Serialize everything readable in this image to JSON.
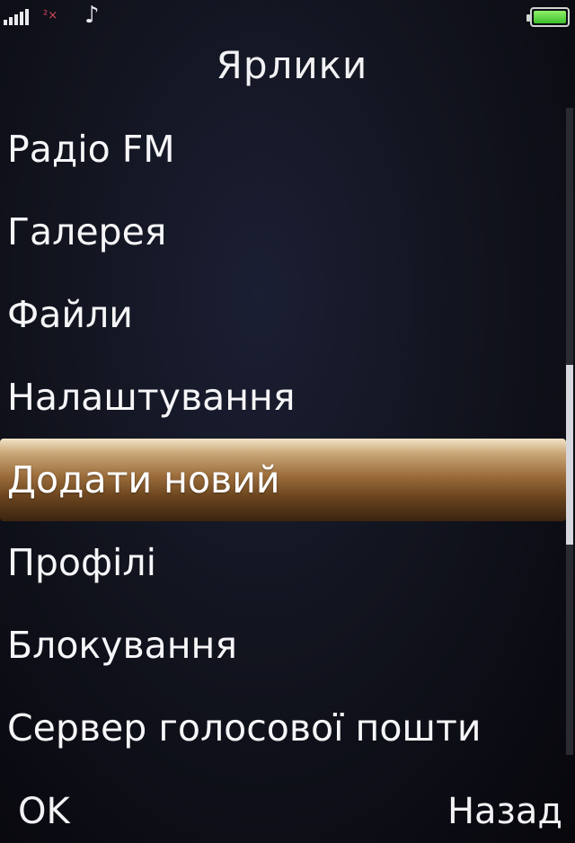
{
  "status_bar": {
    "signal_icon": "signal-strength-icon",
    "network_mark": "²×",
    "music_icon_glyph": "♪",
    "battery_level": 1.0,
    "battery_color": "#4fcf38"
  },
  "title": "Ярлики",
  "menu": {
    "items": [
      {
        "label": "Радіо FM"
      },
      {
        "label": "Галерея"
      },
      {
        "label": "Файли"
      },
      {
        "label": "Налаштування"
      },
      {
        "label": "Додати новий"
      },
      {
        "label": "Профілі"
      },
      {
        "label": "Блокування"
      },
      {
        "label": "Сервер голосової пошти"
      }
    ],
    "selected_index": 4,
    "highlight_color": "#9c6d3b"
  },
  "scrollbar": {
    "position_fraction": 0.55
  },
  "softkeys": {
    "left": "OK",
    "right": "Назад"
  }
}
